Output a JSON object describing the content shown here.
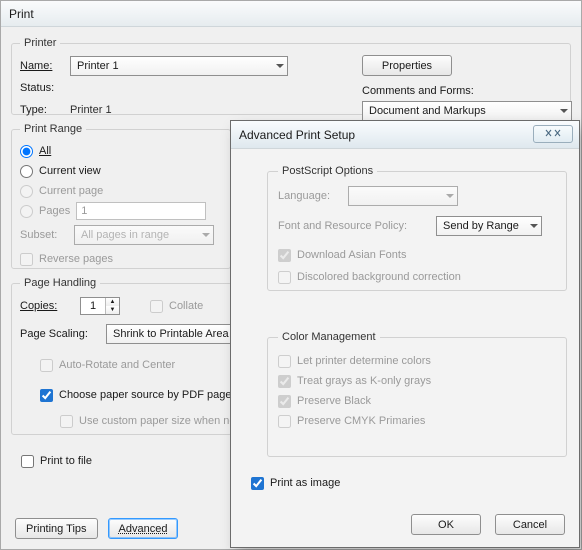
{
  "print": {
    "title": "Print",
    "printerGroup": "Printer",
    "nameLabel": "Name:",
    "nameValue": "Printer 1",
    "statusLabel": "Status:",
    "statusValue": "",
    "typeLabel": "Type:",
    "typeValue": "Printer 1",
    "propertiesBtn": "Properties",
    "commentsFormsLabel": "Comments and Forms:",
    "commentsFormsValue": "Document and Markups",
    "range": {
      "legend": "Print Range",
      "all": "All",
      "currentView": "Current view",
      "currentPage": "Current page",
      "pagesLabel": "Pages",
      "pagesValue": "1",
      "subsetLabel": "Subset:",
      "subsetValue": "All pages in range",
      "reverse": "Reverse pages"
    },
    "page": {
      "legend": "Page Handling",
      "copiesLabel": "Copies:",
      "copiesValue": "1",
      "collate": "Collate",
      "scalingLabel": "Page Scaling:",
      "scalingValue": "Shrink to Printable Area",
      "autoRotate": "Auto-Rotate and Center",
      "chooseSource": "Choose paper source by PDF page size",
      "customSize": "Use custom paper size when needed"
    },
    "printToFile": "Print to file",
    "printingTips": "Printing Tips",
    "advanced": "Advanced"
  },
  "advanced": {
    "title": "Advanced Print Setup",
    "ps": {
      "legend": "PostScript Options",
      "languageLabel": "Language:",
      "languageValue": "",
      "frpLabel": "Font and Resource Policy:",
      "frpValue": "Send by Range",
      "downloadAsian": "Download Asian Fonts",
      "discolored": "Discolored background correction"
    },
    "cm": {
      "legend": "Color Management",
      "letPrinter": "Let printer determine colors",
      "treatGrays": "Treat grays as K-only grays",
      "preserveBlack": "Preserve Black",
      "preserveCMYK": "Preserve CMYK Primaries"
    },
    "printAsImage": "Print as image",
    "ok": "OK",
    "cancel": "Cancel"
  }
}
